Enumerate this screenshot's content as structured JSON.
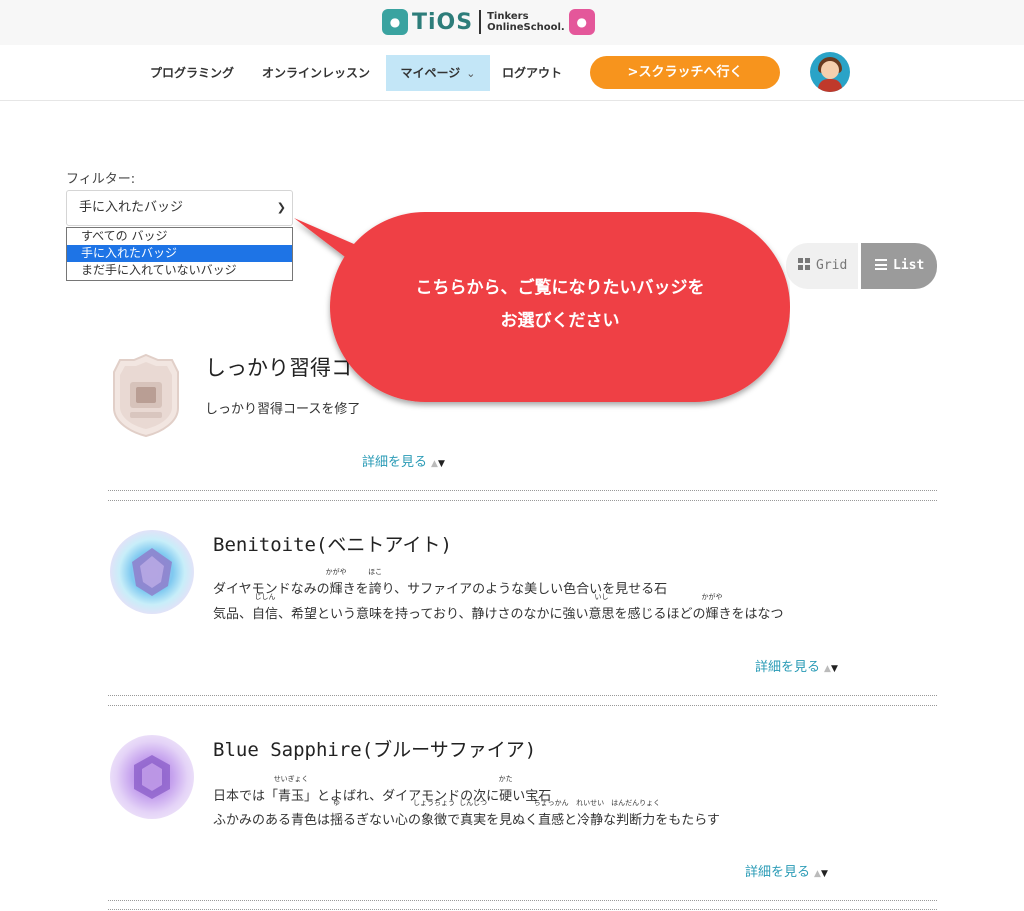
{
  "header": {
    "brand_short": "TiOS",
    "brand_line1": "Tinkers",
    "brand_line2": "OnlineSchool."
  },
  "nav": {
    "items": [
      {
        "label": "プログラミング"
      },
      {
        "label": "オンラインレッスン"
      },
      {
        "label": "マイページ"
      },
      {
        "label": "ログアウト"
      }
    ],
    "scratch_button": ">スクラッチへ行く",
    "accent_color": "#f7941d",
    "active_color": "#c3e6f7"
  },
  "filter": {
    "label": "フィルター:",
    "selected": "手に入れたバッジ",
    "options": [
      "すべての バッジ",
      "手に入れたバッジ",
      "まだ手に入れていないバッジ"
    ]
  },
  "view_toggle": {
    "grid_label": "Grid",
    "list_label": "List",
    "active": "List"
  },
  "callout": {
    "line1": "こちらから、ご覧になりたいバッジを",
    "line2": "お選びください",
    "color": "#ef4044"
  },
  "badges": [
    {
      "title": "しっかり習得コ",
      "desc1": "しっかり習得コースを修了",
      "more": "詳細を見る"
    },
    {
      "title": "Benitoite(ベニトアイト)",
      "desc1_a": "ダイヤモンドなみの",
      "desc1_r1": "輝",
      "desc1_r1_ruby": "かがや",
      "desc1_b": "きを",
      "desc1_r2": "誇",
      "desc1_r2_ruby": "ほこ",
      "desc1_c": "り、サファイアのような美しい色合いを見せる石",
      "desc2_a": "気品、",
      "desc2_r1": "自信",
      "desc2_r1_ruby": "じしん",
      "desc2_b": "、希望という意味を持っており、静けさのなかに強い",
      "desc2_r2": "意思",
      "desc2_r2_ruby": "いし",
      "desc2_c": "を感じるほどの",
      "desc2_r3": "輝",
      "desc2_r3_ruby": "かがや",
      "desc2_d": "きをはなつ",
      "more": "詳細を見る"
    },
    {
      "title": "Blue Sapphire(ブルーサファイア)",
      "desc1_a": "日本では「",
      "desc1_r1": "青玉",
      "desc1_r1_ruby": "せいぎょく",
      "desc1_b": "」とよばれ、ダイアモンドの次に",
      "desc1_r2": "硬",
      "desc1_r2_ruby": "かた",
      "desc1_c": "い宝石",
      "desc2_a": "ふかみのある青色は",
      "desc2_r1": "揺",
      "desc2_r1_ruby": "ゆ",
      "desc2_b": "るぎない心の",
      "desc2_r2": "象徴",
      "desc2_r2_ruby": "しょうちょう",
      "desc2_c": "で",
      "desc2_r3": "真実",
      "desc2_r3_ruby": "しんじつ",
      "desc2_d": "を見ぬく",
      "desc2_r4": "直感",
      "desc2_r4_ruby": "ちょっかん",
      "desc2_e": "と",
      "desc2_r5": "冷静",
      "desc2_r5_ruby": "れいせい",
      "desc2_f": "な",
      "desc2_r6": "判断力",
      "desc2_r6_ruby": "はんだんりょく",
      "desc2_g": "をもたらす",
      "more": "詳細を見る"
    }
  ]
}
